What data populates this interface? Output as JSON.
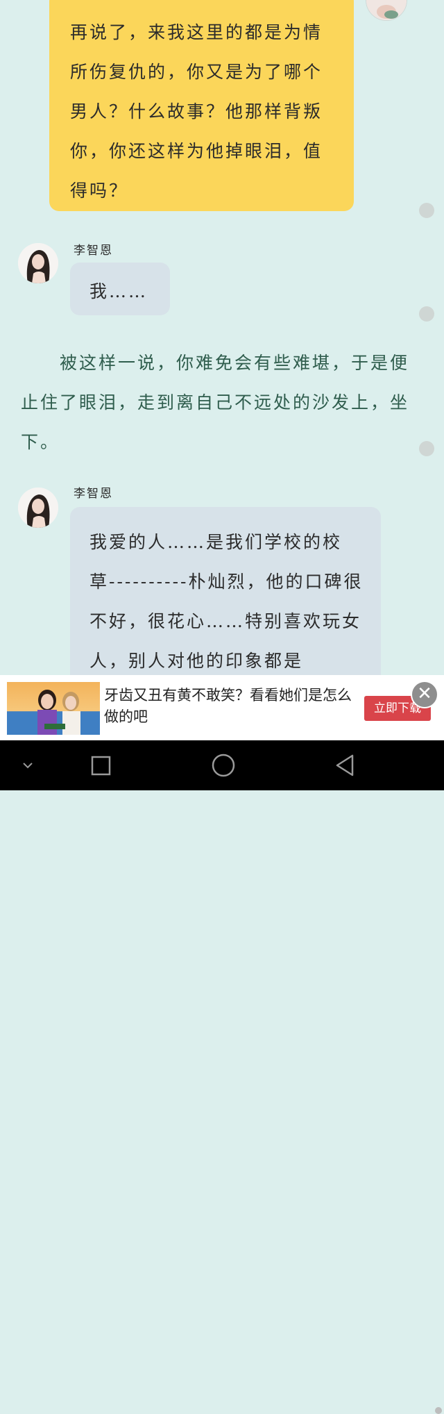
{
  "messages": {
    "top_bubble": "再说了，来我这里的都是为情所伤复仇的，你又是为了哪个男人？什么故事？他那样背叛你，你还这样为他掉眼泪，值得吗？",
    "sender1": "李智恩",
    "reply1": "我……",
    "narration": "被这样一说，你难免会有些难堪，于是便止住了眼泪，走到离自己不远处的沙发上，坐下。",
    "sender2": "李智恩",
    "reply2": "我爱的人……是我们学校的校草----------朴灿烈，他的口碑很不好，很花心……特别喜欢玩女人，别人对他的印象都是"
  },
  "ad": {
    "text": "牙齿又丑有黄不敢笑？看看她们是怎么做的吧",
    "button": "立即下载",
    "close": "✕"
  },
  "colors": {
    "background": "#dcefed",
    "my_bubble": "#fbd65a",
    "their_bubble": "#d7e2e9",
    "narration_text": "#2f5d4d",
    "ad_button": "#d9444a"
  }
}
